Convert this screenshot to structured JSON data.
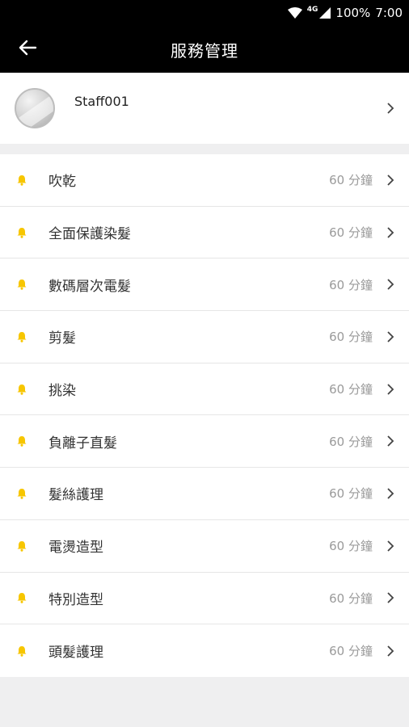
{
  "status_bar": {
    "network": "4G",
    "battery": "100%",
    "time": "7:00"
  },
  "header": {
    "title": "服務管理"
  },
  "profile": {
    "name": "Staff001"
  },
  "services": [
    {
      "name": "吹乾",
      "duration": "60 分鐘"
    },
    {
      "name": "全面保護染髮",
      "duration": "60 分鐘"
    },
    {
      "name": "數碼層次電髮",
      "duration": "60 分鐘"
    },
    {
      "name": "剪髮",
      "duration": "60 分鐘"
    },
    {
      "name": "挑染",
      "duration": "60 分鐘"
    },
    {
      "name": "負離子直髮",
      "duration": "60 分鐘"
    },
    {
      "name": "髮絲護理",
      "duration": "60 分鐘"
    },
    {
      "name": "電燙造型",
      "duration": "60 分鐘"
    },
    {
      "name": "特別造型",
      "duration": "60 分鐘"
    },
    {
      "name": "頭髮護理",
      "duration": "60 分鐘"
    }
  ],
  "colors": {
    "bell": "#f7c600",
    "app_bar": "#000000"
  }
}
